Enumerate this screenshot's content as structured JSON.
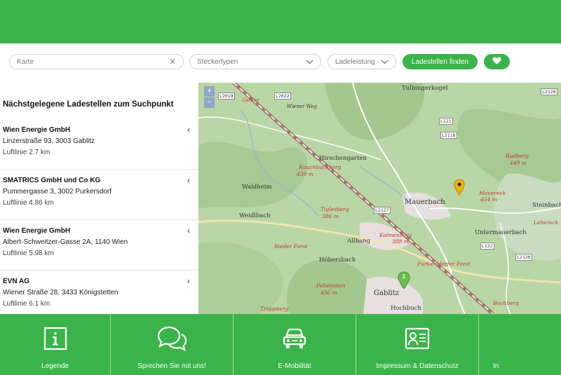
{
  "search": {
    "location_placeholder": "Karte",
    "clear_icon": "close-icon",
    "plug_types_label": "Steckertypen",
    "power_label": "Ladeleistung",
    "find_button_label": "Ladestellen finden",
    "favorite_icon": "heart-icon"
  },
  "sidebar": {
    "title": "Nächstgelegene Ladestellen zum Suchpunkt",
    "results": [
      {
        "operator": "Wien Energie GmbH",
        "address": "Linzerstraße 93, 3003 Gablitz",
        "distance": "Luftlinie 2.7 km"
      },
      {
        "operator": "SMATRICS GmbH und Co KG",
        "address": "Pummergasse 3, 3002 Purkersdorf",
        "distance": "Luftlinie 4.86 km"
      },
      {
        "operator": "Wien Energie GmbH",
        "address": "Albert-Schweitzer-Gasse 2A, 1140 Wien",
        "distance": "Luftlinie 5.98 km"
      },
      {
        "operator": "EVN AG",
        "address": "Wiener Straße 28, 3433 Königstetten",
        "distance": "Luftlinie 6.1 km"
      }
    ]
  },
  "map": {
    "zoom_in": "+",
    "zoom_out": "−",
    "places": [
      "Tulbingerkogel",
      "Hirschengarten",
      "Waldheim",
      "Weidlbach",
      "Mauerbach",
      "Steinbach",
      "Untermauerbach",
      "Allhang",
      "Höbersbach",
      "Gablitz",
      "Hochbuch"
    ],
    "terrain_labels": [
      "Rauchbuchberg",
      "439 m",
      "Tiglesberg",
      "386 m",
      "Kolmenberg",
      "388 m",
      "Rieder Forst",
      "Purkersdorfer Forst",
      "Pellenstein",
      "456 m",
      "Buchberg",
      "Mauereck",
      "454 m",
      "Troppberg",
      "Rudberg",
      "449 m",
      "Gsiller",
      "Lebereck",
      "Wiener Weg"
    ],
    "roads": [
      "L2019",
      "L2022",
      "L2120",
      "L121",
      "L2127",
      "L122",
      "L2120",
      "L2118"
    ],
    "cluster_count": "1",
    "marker_colors": {
      "station": "#f0b400",
      "cluster": "#6abf4b"
    }
  },
  "bottom_nav": [
    {
      "label": "Legende",
      "icon": "info-icon"
    },
    {
      "label": "Sprechen Sie mit uns!",
      "icon": "chat-bubbles-icon"
    },
    {
      "label": "E-Mobilität",
      "icon": "car-icon"
    },
    {
      "label": "Impressum & Datenschutz",
      "icon": "id-card-icon"
    },
    {
      "label": "In",
      "icon": "more-icon"
    }
  ],
  "colors": {
    "brand_green": "#3ab44a"
  }
}
